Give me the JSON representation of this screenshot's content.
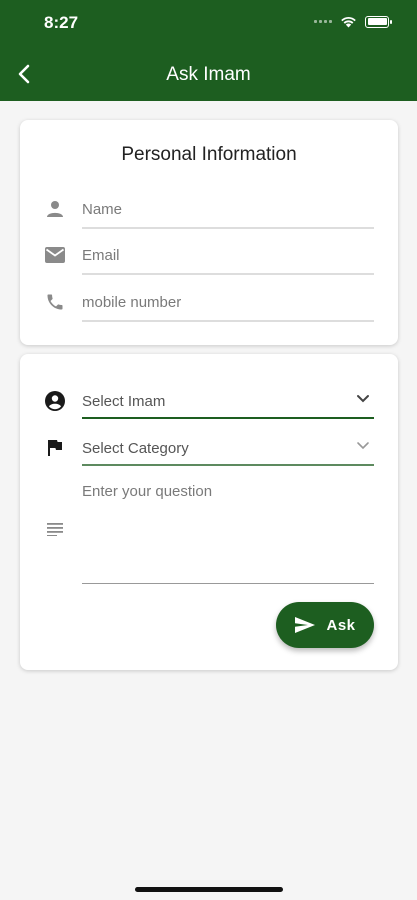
{
  "status_bar": {
    "time": "8:27"
  },
  "app_bar": {
    "title": "Ask Imam"
  },
  "personal_info": {
    "title": "Personal Information",
    "name_placeholder": "Name",
    "email_placeholder": "Email",
    "mobile_placeholder": "mobile number"
  },
  "question_form": {
    "imam_select": "Select Imam",
    "category_select": "Select Category",
    "question_placeholder": "Enter your question",
    "ask_label": "Ask"
  },
  "colors": {
    "primary": "#1d5e20",
    "background": "#f5f5f5",
    "card": "#ffffff",
    "placeholder": "#7a7a7a"
  },
  "icons": {
    "back": "chevron-left-icon",
    "name": "person-icon",
    "email": "mail-icon",
    "mobile": "phone-icon",
    "imam": "account-circle-icon",
    "category": "flag-icon",
    "question": "notes-icon",
    "send": "send-icon"
  }
}
